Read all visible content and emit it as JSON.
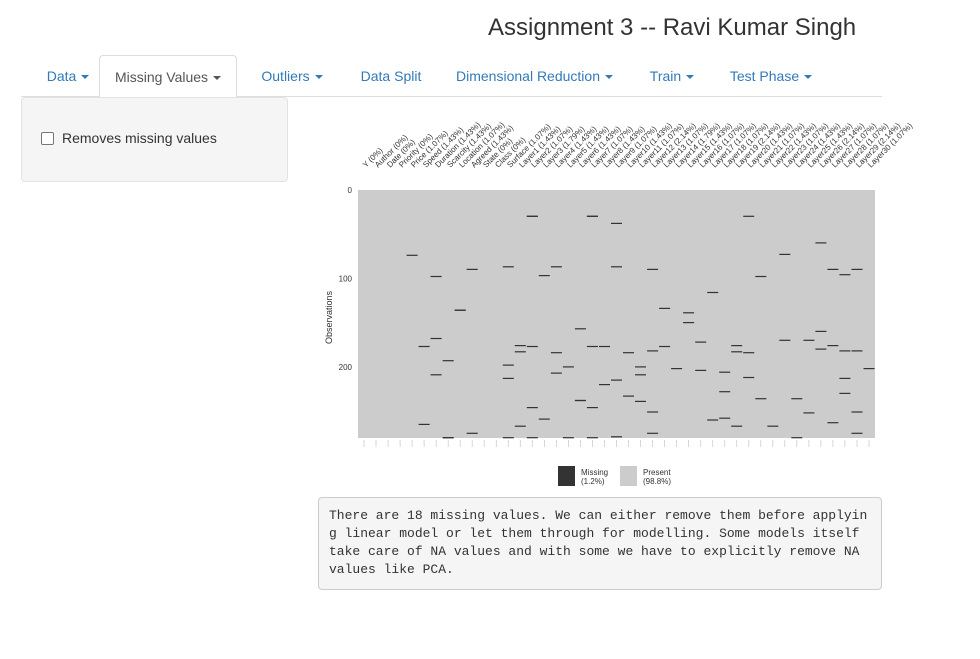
{
  "header": {
    "title": "Assignment 3 -- Ravi Kumar Singh"
  },
  "tabs": [
    {
      "label": "Data",
      "dropdown": true,
      "active": false
    },
    {
      "label": "Missing Values",
      "dropdown": true,
      "active": true
    },
    {
      "label": "Outliers",
      "dropdown": true,
      "active": false
    },
    {
      "label": "Data Split",
      "dropdown": false,
      "active": false
    },
    {
      "label": "Dimensional Reduction",
      "dropdown": true,
      "active": false
    },
    {
      "label": "Train",
      "dropdown": true,
      "active": false
    },
    {
      "label": "Test Phase",
      "dropdown": true,
      "active": false
    }
  ],
  "sidebar": {
    "checkbox_label": "Removes missing values",
    "checkbox_checked": false
  },
  "colors": {
    "link": "#337ab7",
    "missing": "#333333",
    "present": "#cccccc"
  },
  "chart_data": {
    "type": "heatmap",
    "ylabel": "Observations",
    "y_ticks": [
      0,
      100,
      200
    ],
    "n_observations": 280,
    "columns": [
      "Y (0%)",
      "Author (0%)",
      "Date (0%)",
      "Priority (0%)",
      "Price (1.07%)",
      "Speed (1.43%)",
      "Duration (1.43%)",
      "Scarcity (1.43%)",
      "Location (1.07%)",
      "Agreed (1.43%)",
      "State (0%)",
      "Class (0%)",
      "Surface (1.07%)",
      "Layer1 (1.43%)",
      "Layer2 (1.07%)",
      "Layer3 (1.79%)",
      "Layer4 (1.43%)",
      "Layer5 (1.43%)",
      "Layer6 (1.43%)",
      "Layer7 (1.07%)",
      "Layer8 (1.43%)",
      "Layer9 (1.07%)",
      "Layer10 (1.43%)",
      "Layer11 (1.07%)",
      "Layer12 (2.14%)",
      "Layer13 (1.07%)",
      "Layer14 (1.79%)",
      "Layer15 (1.43%)",
      "Layer16 (1.07%)",
      "Layer17 (1.07%)",
      "Layer18 (1.07%)",
      "Layer19 (2.14%)",
      "Layer20 (1.43%)",
      "Layer21 (1.07%)",
      "Layer22 (1.43%)",
      "Layer23 (1.07%)",
      "Layer24 (1.43%)",
      "Layer25 (1.43%)",
      "Layer26 (2.14%)",
      "Layer27 (1.07%)",
      "Layer28 (1.07%)",
      "Layer29 (2.14%)",
      "Layer30 (1.07%)"
    ],
    "missing_rows": [
      [],
      [],
      [],
      [],
      [
        73
      ],
      [
        176,
        264
      ],
      [
        97,
        167,
        208
      ],
      [
        192,
        280,
        279
      ],
      [
        135,
        135
      ],
      [
        89,
        274
      ],
      [],
      [],
      [
        86,
        197,
        212,
        280
      ],
      [
        175,
        182,
        266
      ],
      [
        29,
        29,
        176,
        245,
        279
      ],
      [
        96,
        258
      ],
      [
        86,
        183,
        206
      ],
      [
        282,
        199
      ],
      [
        156,
        237,
        237
      ],
      [
        29,
        29,
        176,
        245,
        279
      ],
      [
        176,
        219
      ],
      [
        37,
        86,
        214,
        278
      ],
      [
        183,
        232
      ],
      [
        208,
        199,
        238
      ],
      [
        89,
        181,
        250,
        274
      ],
      [
        176,
        133
      ],
      [
        201
      ],
      [
        138,
        149
      ],
      [
        203,
        171
      ],
      [
        259,
        115
      ],
      [
        205,
        227,
        257
      ],
      [
        175,
        182,
        266
      ],
      [
        29,
        183,
        211
      ],
      [
        97,
        235
      ],
      [
        266
      ],
      [
        72,
        169
      ],
      [
        235,
        279
      ],
      [
        169,
        251
      ],
      [
        59,
        159,
        179
      ],
      [
        89,
        175,
        262
      ],
      [
        95,
        181,
        212,
        229
      ],
      [
        89,
        181,
        250,
        274
      ],
      [
        201
      ]
    ],
    "legend": [
      {
        "label": "Missing",
        "percent": "(1.2%)"
      },
      {
        "label": "Present",
        "percent": "(98.8%)"
      }
    ]
  },
  "note": {
    "text": "There are 18 missing values. We can either remove them before applying linear model or let them through for modelling. Some models itself take care of NA values and with some we have to explicitly remove NA values like PCA."
  }
}
